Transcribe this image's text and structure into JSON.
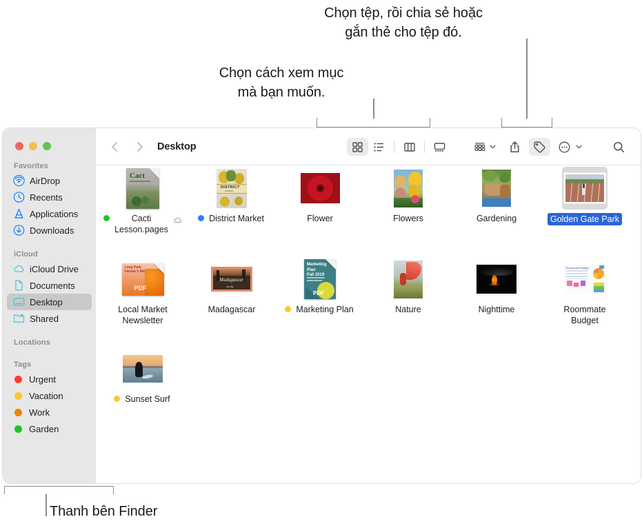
{
  "callouts": {
    "share_tag": "Chọn tệp, rồi chia sẻ hoặc\ngắn thẻ cho tệp đó.",
    "view_mode": "Chọn cách xem mục\nmà bạn muốn.",
    "sidebar": "Thanh bên Finder"
  },
  "window": {
    "traffic_lights": [
      "close",
      "minimize",
      "zoom"
    ]
  },
  "toolbar": {
    "back_label": "Back",
    "forward_label": "Forward",
    "title": "Desktop",
    "view_buttons": [
      {
        "name": "icon-view",
        "label": "Dạng biểu tượng",
        "active": true
      },
      {
        "name": "list-view",
        "label": "Dạng danh sách",
        "active": false
      },
      {
        "name": "column-view",
        "label": "Dạng cột",
        "active": false
      },
      {
        "name": "gallery-view",
        "label": "Dạng thư viện",
        "active": false
      }
    ],
    "group_label": "Nhóm",
    "share_label": "Chia sẻ",
    "tag_label": "Thẻ",
    "more_label": "Thêm",
    "search_label": "Tìm kiếm"
  },
  "sidebar": {
    "sections": [
      {
        "title": "Favorites",
        "items": [
          {
            "label": "AirDrop",
            "icon": "airdrop-icon",
            "color": "#0a84ff",
            "selected": false
          },
          {
            "label": "Recents",
            "icon": "clock-icon",
            "color": "#0a84ff",
            "selected": false
          },
          {
            "label": "Applications",
            "icon": "applications-icon",
            "color": "#0a84ff",
            "selected": false
          },
          {
            "label": "Downloads",
            "icon": "downloads-icon",
            "color": "#0a84ff",
            "selected": false
          }
        ]
      },
      {
        "title": "iCloud",
        "items": [
          {
            "label": "iCloud Drive",
            "icon": "cloud-icon",
            "color": "#4ec3de",
            "selected": false
          },
          {
            "label": "Documents",
            "icon": "document-icon",
            "color": "#4ec3de",
            "selected": false
          },
          {
            "label": "Desktop",
            "icon": "desktop-icon",
            "color": "#4ec3de",
            "selected": true
          },
          {
            "label": "Shared",
            "icon": "shared-folder-icon",
            "color": "#4ec3de",
            "selected": false
          }
        ]
      },
      {
        "title": "Locations",
        "items": []
      },
      {
        "title": "Tags",
        "items": [
          {
            "label": "Urgent",
            "icon": "tag-dot",
            "color": "#fc3b30",
            "selected": false
          },
          {
            "label": "Vacation",
            "icon": "tag-dot",
            "color": "#fbc82e",
            "selected": false
          },
          {
            "label": "Work",
            "icon": "tag-dot",
            "color": "#ef8100",
            "selected": false
          },
          {
            "label": "Garden",
            "icon": "tag-dot",
            "color": "#19c622",
            "selected": false
          }
        ]
      }
    ]
  },
  "files": [
    {
      "name": "Cacti\nLesson.pages",
      "tag_color": "#19c622",
      "cloud": true,
      "selected": false,
      "kind": "pages-document"
    },
    {
      "name": "District Market",
      "tag_color": "#2b7ef5",
      "cloud": false,
      "selected": false,
      "kind": "photo-portrait"
    },
    {
      "name": "Flower",
      "tag_color": null,
      "cloud": false,
      "selected": false,
      "kind": "photo-landscape"
    },
    {
      "name": "Flowers",
      "tag_color": null,
      "cloud": false,
      "selected": false,
      "kind": "photo-portrait"
    },
    {
      "name": "Gardening",
      "tag_color": null,
      "cloud": false,
      "selected": false,
      "kind": "photo-portrait"
    },
    {
      "name": "Golden Gate Park",
      "tag_color": null,
      "cloud": false,
      "selected": true,
      "kind": "photo-landscape"
    },
    {
      "name": "Local Market\nNewsletter",
      "tag_color": null,
      "cloud": false,
      "selected": false,
      "kind": "pdf-document"
    },
    {
      "name": "Madagascar",
      "tag_color": null,
      "cloud": false,
      "selected": false,
      "kind": "photo-landscape"
    },
    {
      "name": "Marketing Plan",
      "tag_color": "#fbc82e",
      "cloud": false,
      "selected": false,
      "kind": "pdf-document"
    },
    {
      "name": "Nature",
      "tag_color": null,
      "cloud": false,
      "selected": false,
      "kind": "photo-portrait"
    },
    {
      "name": "Nighttime",
      "tag_color": null,
      "cloud": false,
      "selected": false,
      "kind": "photo-landscape"
    },
    {
      "name": "Roommate\nBudget",
      "tag_color": null,
      "cloud": false,
      "selected": false,
      "kind": "numbers-document"
    },
    {
      "name": "Sunset Surf",
      "tag_color": "#fbc82e",
      "cloud": false,
      "selected": false,
      "kind": "photo-landscape"
    }
  ]
}
